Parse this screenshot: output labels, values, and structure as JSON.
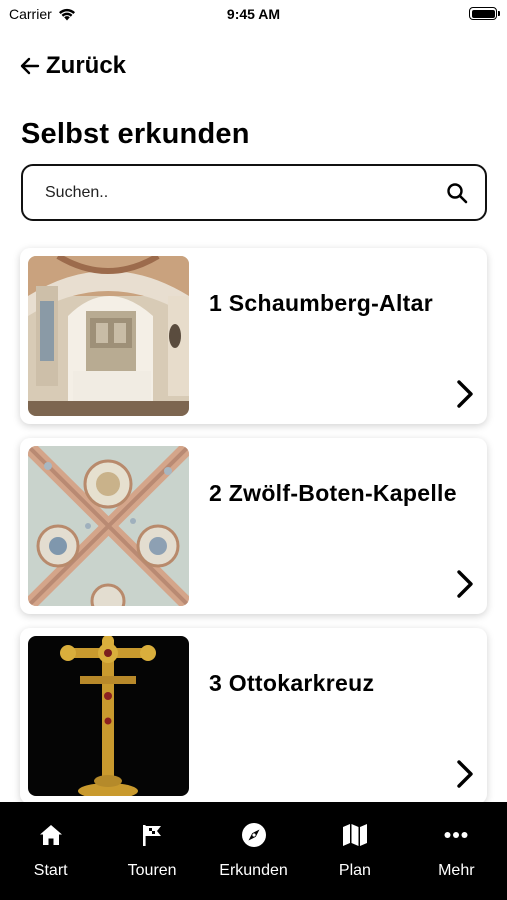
{
  "status_bar": {
    "carrier": "Carrier",
    "time": "9:45 AM"
  },
  "nav": {
    "back_label": "Zurück"
  },
  "page": {
    "title": "Selbst erkunden"
  },
  "search": {
    "placeholder": "Suchen..",
    "value": ""
  },
  "items": [
    {
      "title": "1 Schaumberg-Altar",
      "image": "altar-photo"
    },
    {
      "title": "2 Zwölf-Boten-Kapelle",
      "image": "ceiling-fresco-photo"
    },
    {
      "title": "3 Ottokarkreuz",
      "image": "golden-cross-photo"
    }
  ],
  "tabbar": {
    "tabs": [
      {
        "label": "Start",
        "icon": "home-icon"
      },
      {
        "label": "Touren",
        "icon": "flag-icon"
      },
      {
        "label": "Erkunden",
        "icon": "compass-icon"
      },
      {
        "label": "Plan",
        "icon": "map-icon"
      },
      {
        "label": "Mehr",
        "icon": "more-icon"
      }
    ]
  },
  "colors": {
    "tabbar_bg": "#000000",
    "text": "#000000",
    "card_bg": "#ffffff"
  }
}
